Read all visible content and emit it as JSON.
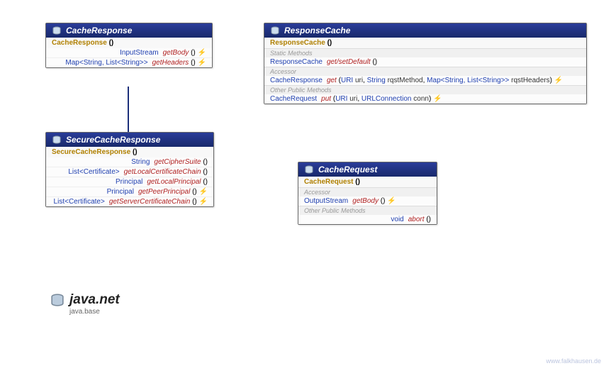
{
  "cacheResponse": {
    "title": "CacheResponse",
    "ctor": "CacheResponse",
    "m1_ret": "InputStream",
    "m1_name": "getBody",
    "m2_ret_a": "Map",
    "m2_ret_b": "String",
    "m2_ret_c": "List",
    "m2_ret_d": "String",
    "m2_name": "getHeaders"
  },
  "secureCacheResponse": {
    "title": "SecureCacheResponse",
    "ctor": "SecureCacheResponse",
    "m1_ret": "String",
    "m1_name": "getCipherSuite",
    "m2_ret_a": "List",
    "m2_ret_b": "Certificate",
    "m2_name": "getLocalCertificateChain",
    "m3_ret": "Principal",
    "m3_name": "getLocalPrincipal",
    "m4_ret": "Principal",
    "m4_name": "getPeerPrincipal",
    "m5_ret_a": "List",
    "m5_ret_b": "Certificate",
    "m5_name": "getServerCertificateChain"
  },
  "responseCache": {
    "title": "ResponseCache",
    "ctor": "ResponseCache",
    "sec1": "Static Methods",
    "m1_ret": "ResponseCache",
    "m1_name": "get/setDefault",
    "sec2": "Accessor",
    "m2_ret": "CacheResponse",
    "m2_name": "get",
    "m2_p1t": "URI",
    "m2_p1n": "uri",
    "m2_p2t": "String",
    "m2_p2n": "rqstMethod",
    "m2_p3a": "Map",
    "m2_p3b": "String",
    "m2_p3c": "List",
    "m2_p3d": "String",
    "m2_p3n": "rqstHeaders",
    "sec3": "Other Public Methods",
    "m3_ret": "CacheRequest",
    "m3_name": "put",
    "m3_p1t": "URI",
    "m3_p1n": "uri",
    "m3_p2t": "URLConnection",
    "m3_p2n": "conn"
  },
  "cacheRequest": {
    "title": "CacheRequest",
    "ctor": "CacheRequest",
    "sec1": "Accessor",
    "m1_ret": "OutputStream",
    "m1_name": "getBody",
    "sec2": "Other Public Methods",
    "m2_ret": "void",
    "m2_name": "abort"
  },
  "pkg": {
    "name": "java.net",
    "module": "java.base"
  },
  "credit": "www.falkhausen.de",
  "sym": {
    "parens": "()",
    "lt": "<",
    "gt": ">",
    "gt2": ">>",
    "comma": ", ",
    "lparen": "(",
    "rparen": ")",
    "throws": " ⚡"
  }
}
